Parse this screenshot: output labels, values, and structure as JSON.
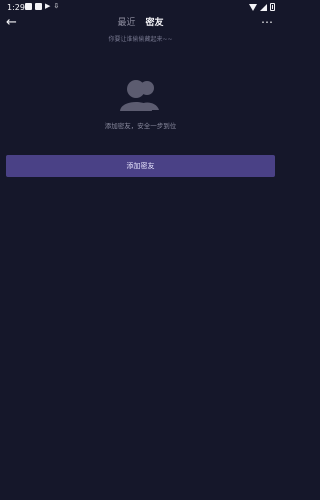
{
  "status_bar": {
    "time": "1:29"
  },
  "header": {
    "tabs": [
      {
        "label": "最近",
        "active": false
      },
      {
        "label": "密友",
        "active": true
      }
    ],
    "subtitle": "你要让谁偷偷藏起来~~"
  },
  "empty_state": {
    "icon": "users-icon",
    "message": "添加密友，安全一步到位"
  },
  "actions": {
    "add_friend_label": "添加密友"
  },
  "colors": {
    "background": "#15172a",
    "button": "#4a4186",
    "icon": "#5c5c70",
    "muted_text": "#8a8b9f"
  }
}
